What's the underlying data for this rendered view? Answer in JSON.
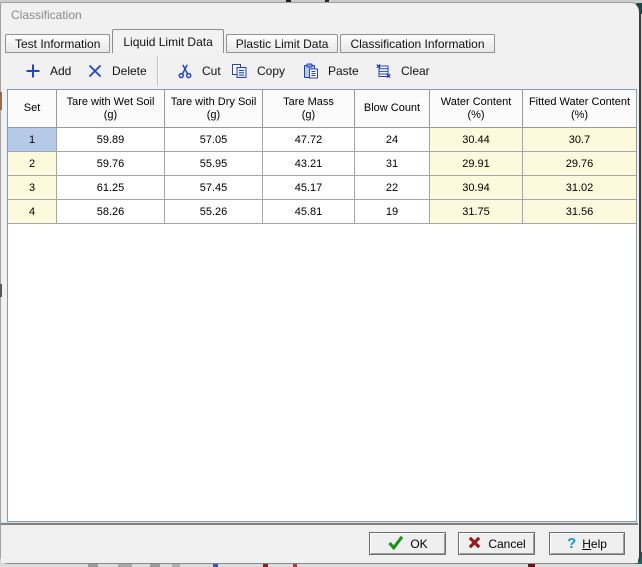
{
  "window": {
    "title": "Classification"
  },
  "tabs": [
    {
      "label": "Test Information",
      "active": false
    },
    {
      "label": "Liquid Limit Data",
      "active": true
    },
    {
      "label": "Plastic Limit Data",
      "active": false
    },
    {
      "label": "Classification Information",
      "active": false
    }
  ],
  "toolbar": {
    "add": "Add",
    "delete": "Delete",
    "cut": "Cut",
    "copy": "Copy",
    "paste": "Paste",
    "clear": "Clear"
  },
  "table": {
    "columns": [
      {
        "title": "Set",
        "unit": ""
      },
      {
        "title": "Tare with Wet Soil",
        "unit": "(g)"
      },
      {
        "title": "Tare with Dry Soil",
        "unit": "(g)"
      },
      {
        "title": "Tare Mass",
        "unit": "(g)"
      },
      {
        "title": "Blow Count",
        "unit": ""
      },
      {
        "title": "Water Content",
        "unit": "(%)"
      },
      {
        "title": "Fitted Water Content",
        "unit": "(%)"
      }
    ],
    "rows": [
      [
        "1",
        "59.89",
        "57.05",
        "47.72",
        "24",
        "30.44",
        "30.7"
      ],
      [
        "2",
        "59.76",
        "55.95",
        "43.21",
        "31",
        "29.91",
        "29.76"
      ],
      [
        "3",
        "61.25",
        "57.45",
        "45.17",
        "22",
        "30.94",
        "31.02"
      ],
      [
        "4",
        "58.26",
        "55.26",
        "45.81",
        "19",
        "31.75",
        "31.56"
      ]
    ],
    "selection": {
      "row": 1,
      "column": "Set"
    }
  },
  "footer": {
    "ok": "OK",
    "cancel": "Cancel",
    "help_key": "H",
    "help_rest": "elp"
  },
  "colors": {
    "selection_blue": "#b5c9e8",
    "readonly_yellow": "#fcf9dc",
    "toolbar_icon_blue": "#2443cb",
    "ok_green": "#149414",
    "cancel_red": "#9e1414",
    "help_blue": "#1596cc",
    "accent_teal": "#2d7174"
  }
}
